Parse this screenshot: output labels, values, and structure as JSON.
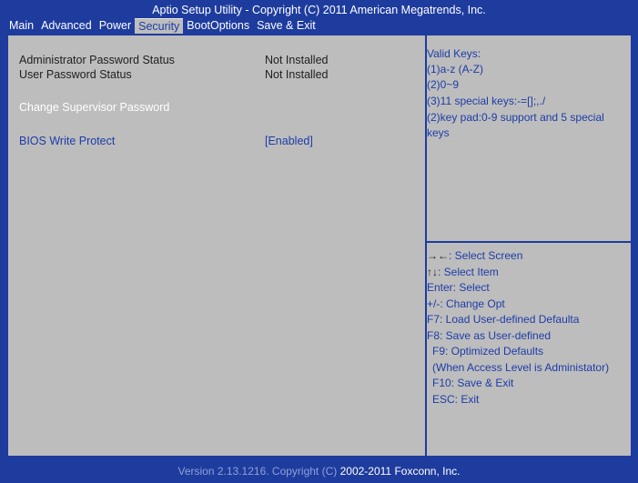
{
  "window": {
    "title": "Aptio Setup Utility - Copyright (C) 2011 American Megatrends, Inc."
  },
  "menu": {
    "tabs": [
      {
        "label": "Main"
      },
      {
        "label": "Advanced"
      },
      {
        "label": "Power"
      },
      {
        "label": "Security"
      },
      {
        "label": "BootOptions"
      },
      {
        "label": "Save & Exit"
      }
    ],
    "active": "Security"
  },
  "main": {
    "admin_pw_label": "Administrator Password Status",
    "admin_pw_value": "Not Installed",
    "user_pw_label": "User Password Status",
    "user_pw_value": "Not Installed",
    "change_supervisor": "Change Supervisor Password",
    "bios_wp_label": "BIOS Write Protect",
    "bios_wp_value": "[Enabled]"
  },
  "help_top": [
    "Valid Keys:",
    "(1)a-z (A-Z)",
    "(2)0~9",
    "(3)11 special keys:-=[];,./",
    "(2)key pad:0-9 support and 5 special",
    "keys"
  ],
  "help_bottom": {
    "select_screen_arrows": "→←",
    "select_screen": ": Select Screen",
    "select_item_arrows": "↑↓",
    "select_item": ": Select Item",
    "lines": [
      "Enter: Select",
      "+/-: Change Opt",
      "F7: Load User-defined Defaulta",
      "F8: Save as User-defined",
      "F9: Optimized Defaults",
      "(When Access Level is Administator)",
      "F10: Save & Exit",
      "ESC: Exit"
    ]
  },
  "footer": {
    "version_prefix": "Version 2.13.1216. Copyright (C)",
    "version_suffix": "2002-2011 Foxconn, Inc."
  },
  "colors": {
    "background": "#1e3c9e",
    "panel": "#bdbdbd",
    "highlight_text": "#1d3ca8"
  }
}
